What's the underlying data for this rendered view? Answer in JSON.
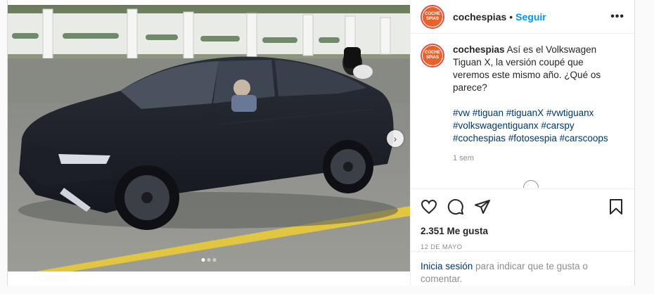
{
  "post": {
    "username": "cochespias",
    "separator": "•",
    "follow_label": "Seguir",
    "more_label": "•••",
    "avatar_text": "COCHE SPIAS",
    "caption_text": "Así es el Volkswagen Tiguan X, la versión coupé que veremos este mismo año. ¿Qué os parece?",
    "hashtags": "#vw #tiguan #tiguanX #vwtiguanx #volkswagentiguanx #carspy #cochespias #fotosespia #carscoops",
    "time_ago": "1 sem",
    "likes": "2.351 Me gusta",
    "date": "12 DE MAYO",
    "next_label": "›"
  },
  "login_prompt": {
    "link": "Inicia sesión",
    "text": " para indicar que te gusta o comentar."
  },
  "colors": {
    "link_blue": "#0095f6",
    "hashtag": "#00376b",
    "muted": "#8e8e8e",
    "brand_avatar": "#e8632b"
  },
  "icons": [
    "heart-icon",
    "comment-icon",
    "share-icon",
    "bookmark-icon",
    "chevron-right-icon",
    "more-icon"
  ]
}
